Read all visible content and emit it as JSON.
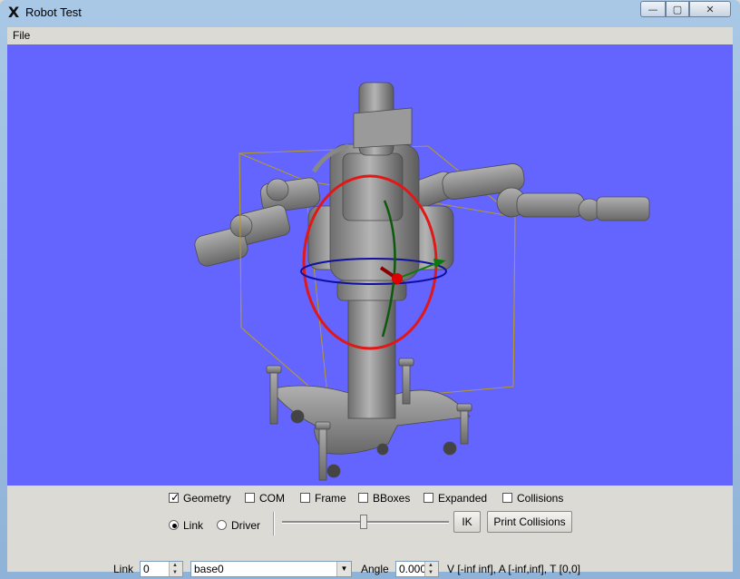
{
  "window": {
    "title": "Robot Test",
    "controls": {
      "minimize": "—",
      "maximize": "▢",
      "close": "✕"
    }
  },
  "menu": {
    "file": "File"
  },
  "viewport": {
    "background": "#6464ff"
  },
  "options": {
    "checkboxes": [
      {
        "label": "Geometry",
        "checked": true
      },
      {
        "label": "COM",
        "checked": false
      },
      {
        "label": "Frame",
        "checked": false
      },
      {
        "label": "BBoxes",
        "checked": false
      },
      {
        "label": "Expanded",
        "checked": false
      },
      {
        "label": "Collisions",
        "checked": false
      }
    ]
  },
  "mode": {
    "link_label": "Link",
    "driver_label": "Driver",
    "selected": "Link"
  },
  "buttons": {
    "ik": "IK",
    "print_collisions": "Print Collisions"
  },
  "slider": {
    "value_fraction": 0.5
  },
  "link": {
    "label": "Link",
    "index": "0",
    "name": "base0"
  },
  "angle": {
    "label": "Angle",
    "value": "0.000"
  },
  "limits_text": "V [-inf inf], A [-inf,inf], T [0,0]"
}
